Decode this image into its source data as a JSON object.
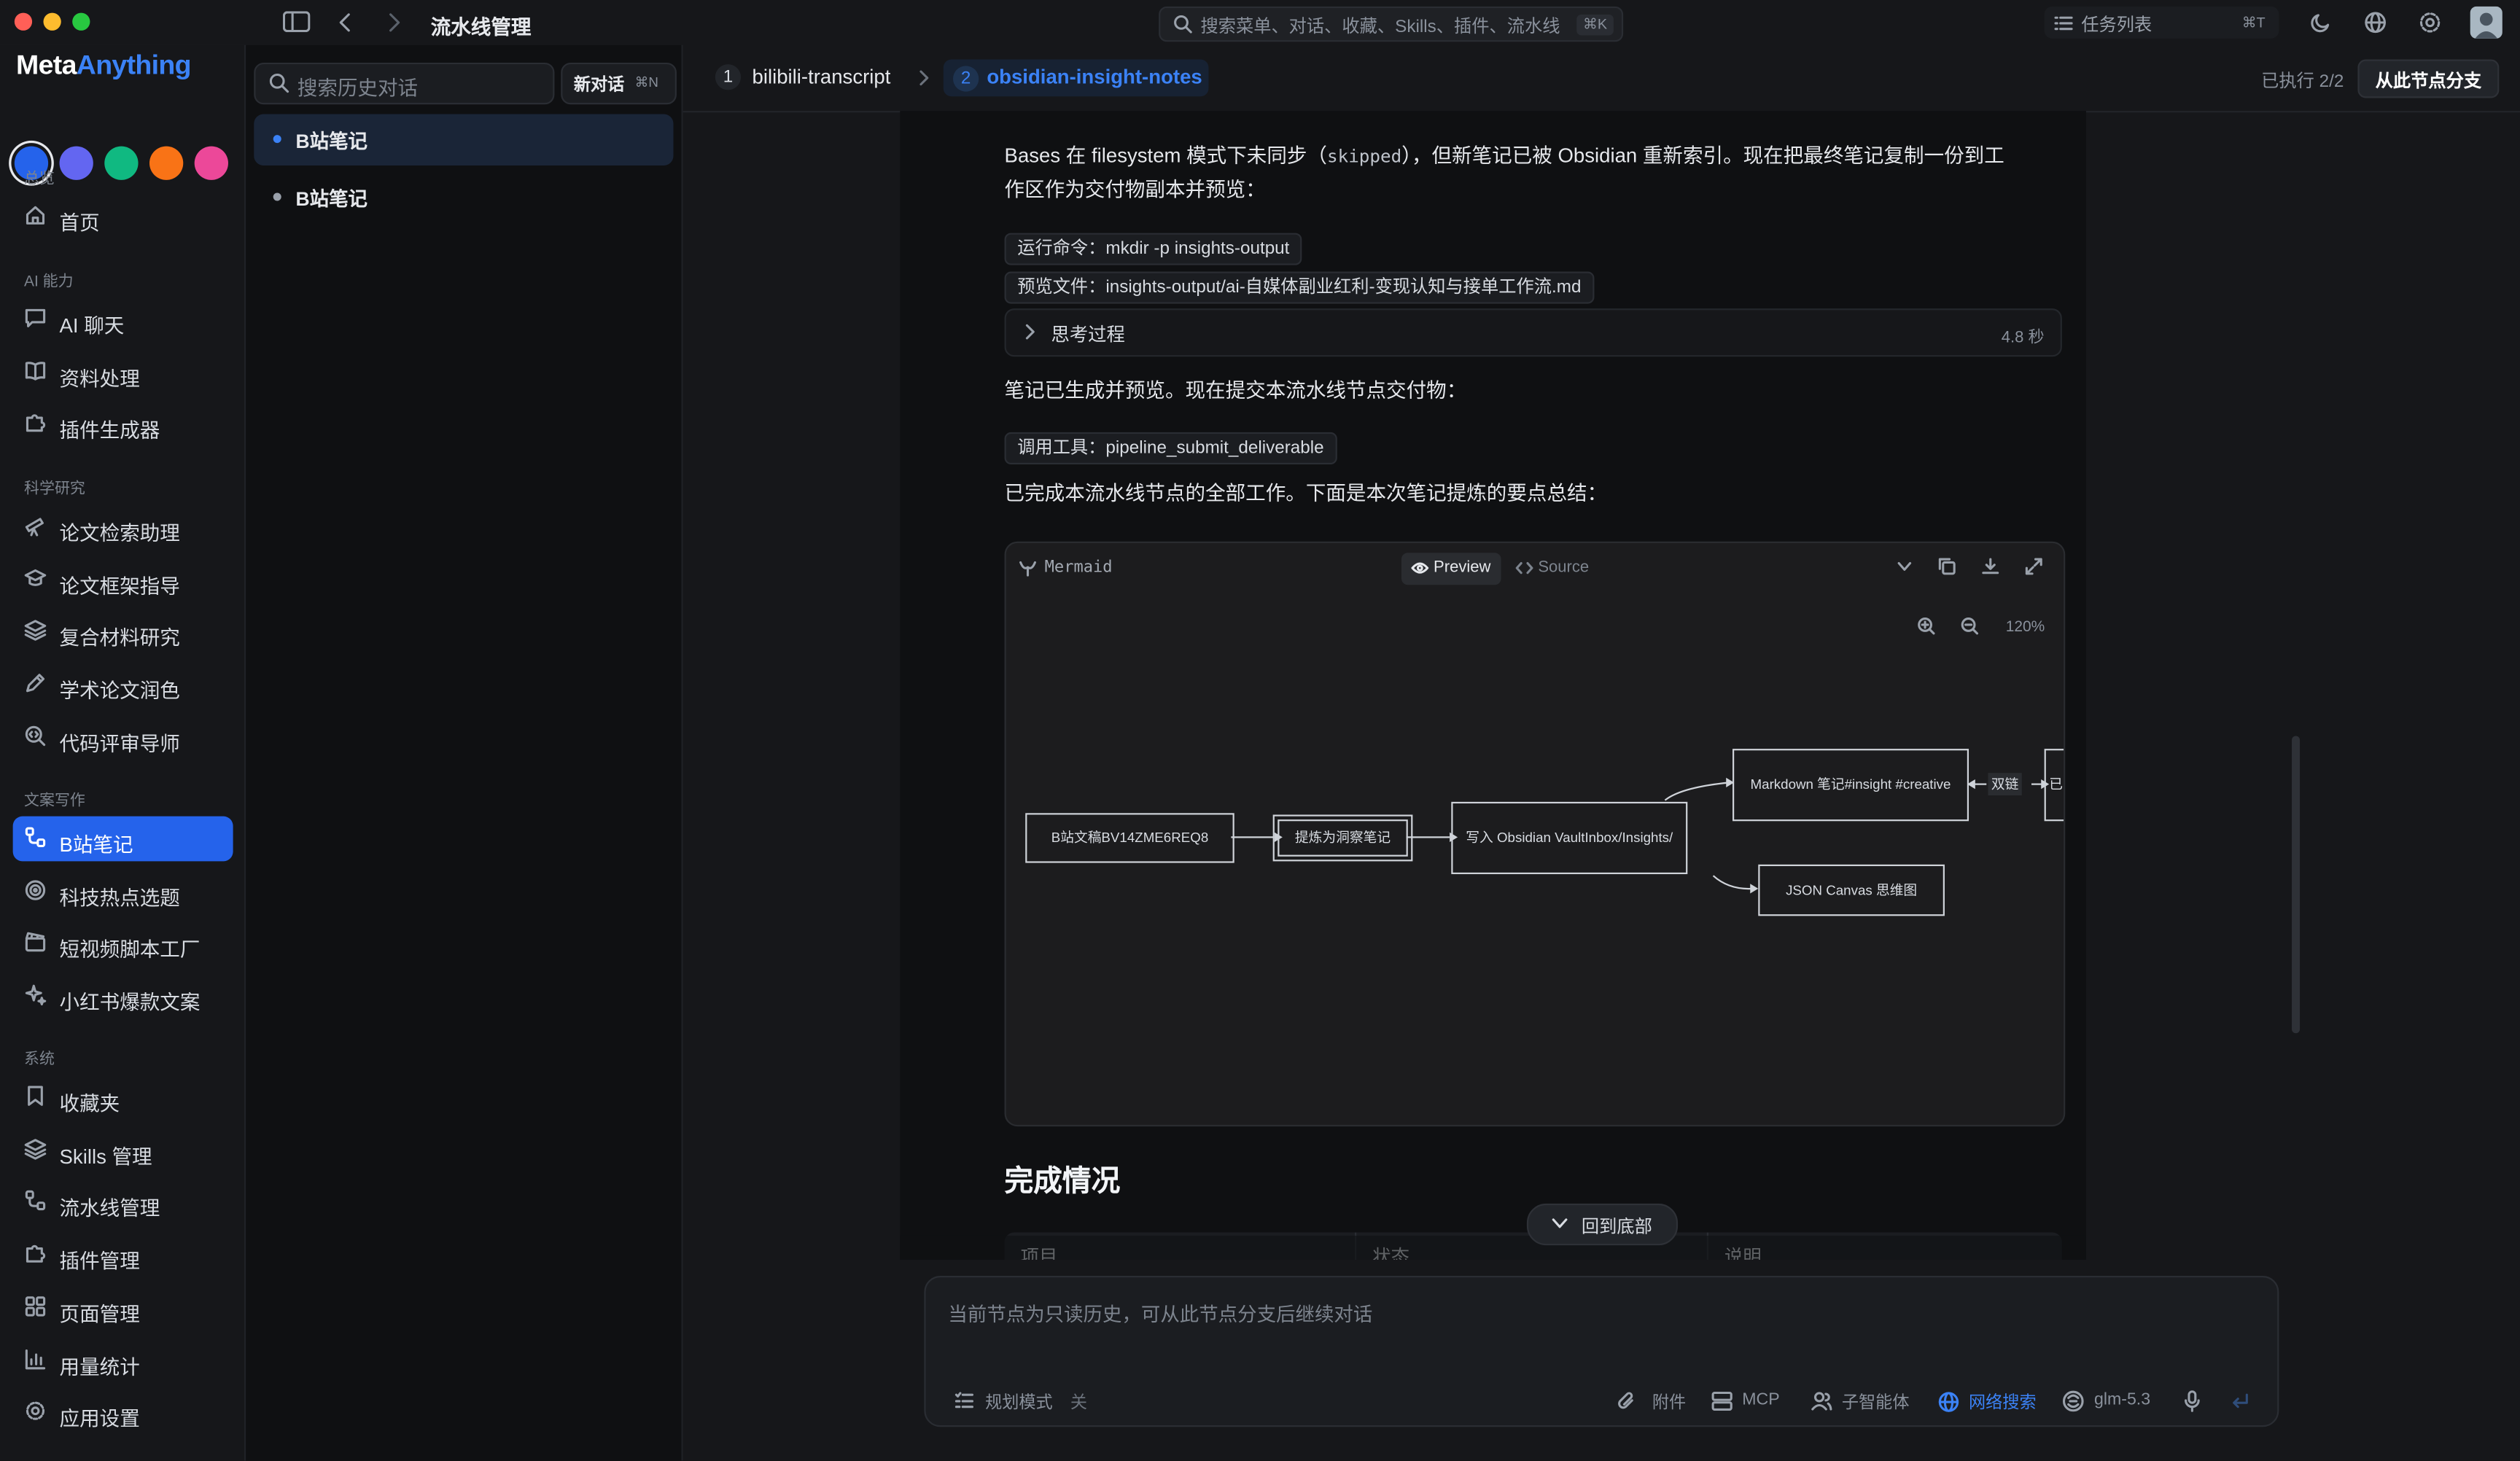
{
  "window": {
    "title": "流水线管理"
  },
  "search": {
    "placeholder": "搜索菜单、对话、收藏、Skills、插件、流水线",
    "shortcut": "⌘K"
  },
  "tasks": {
    "label": "任务列表",
    "shortcut": "⌘T"
  },
  "brand": {
    "part1": "Meta",
    "part2": "Anything",
    "accent": "#3b82f6"
  },
  "theme_colors": [
    "#2563eb",
    "#6366f1",
    "#10b981",
    "#f97316",
    "#ec4899"
  ],
  "sidebar": {
    "sections": [
      {
        "title": "总览",
        "items": [
          {
            "label": "首页",
            "icon": "home-icon"
          }
        ]
      },
      {
        "title": "AI 能力",
        "items": [
          {
            "label": "AI 聊天",
            "icon": "chat-icon"
          },
          {
            "label": "资料处理",
            "icon": "book-icon"
          },
          {
            "label": "插件生成器",
            "icon": "puzzle-icon"
          }
        ]
      },
      {
        "title": "科学研究",
        "items": [
          {
            "label": "论文检索助理",
            "icon": "telescope-icon"
          },
          {
            "label": "论文框架指导",
            "icon": "graduation-cap-icon"
          },
          {
            "label": "复合材料研究",
            "icon": "layers-icon"
          },
          {
            "label": "学术论文润色",
            "icon": "pen-icon"
          },
          {
            "label": "代码评审导师",
            "icon": "code-search-icon"
          }
        ]
      },
      {
        "title": "文案写作",
        "items": [
          {
            "label": "B站笔记",
            "icon": "workflow-icon",
            "active": true
          },
          {
            "label": "科技热点选题",
            "icon": "target-icon"
          },
          {
            "label": "短视频脚本工厂",
            "icon": "clapperboard-icon"
          },
          {
            "label": "小红书爆款文案",
            "icon": "sparkles-icon"
          }
        ]
      },
      {
        "title": "系统",
        "items": [
          {
            "label": "收藏夹",
            "icon": "bookmark-icon"
          },
          {
            "label": "Skills 管理",
            "icon": "layers-icon"
          },
          {
            "label": "流水线管理",
            "icon": "workflow-icon"
          },
          {
            "label": "插件管理",
            "icon": "puzzle-icon"
          },
          {
            "label": "页面管理",
            "icon": "grid-icon"
          },
          {
            "label": "用量统计",
            "icon": "bar-chart-icon"
          },
          {
            "label": "应用设置",
            "icon": "gear-icon"
          }
        ]
      }
    ]
  },
  "history": {
    "search_placeholder": "搜索历史对话",
    "new_chat": "新对话",
    "new_chat_shortcut": "⌘N",
    "items": [
      {
        "label": "B站笔记",
        "active": true
      },
      {
        "label": "B站笔记",
        "active": false
      }
    ]
  },
  "pipeline": {
    "steps": [
      {
        "num": "1",
        "label": "bilibili-transcript",
        "active": false
      },
      {
        "num": "2",
        "label": "obsidian-insight-notes",
        "active": true
      }
    ],
    "status": "已执行 2/2",
    "branch_button": "从此节点分支"
  },
  "message": {
    "para1_a": "Bases 在 filesystem 模式下未同步（",
    "para1_code": "skipped",
    "para1_b": "），但新笔记已被 Obsidian 重新索引。现在把最终笔记复制一份到工",
    "para1_c": "作区作为交付物副本并预览：",
    "cmd1": "运行命令：mkdir -p insights-output",
    "cmd2": "预览文件：insights-output/ai-自媒体副业红利-变现认知与接单工作流.md",
    "thinking_label": "思考过程",
    "thinking_time": "4.8 秒",
    "para2": "笔记已生成并预览。现在提交本流水线节点交付物：",
    "tool_call": "调用工具：pipeline_submit_deliverable",
    "para3": "已完成本流水线节点的全部工作。下面是本次笔记提炼的要点总结："
  },
  "mermaid": {
    "label": "Mermaid",
    "preview": "Preview",
    "source": "Source",
    "zoom": "120%",
    "nodes": {
      "n1": "B站文稿BV14ZME6REQ8",
      "n2": "提炼为洞察笔记",
      "n3": "写入 Obsidian VaultInbox/Insights/",
      "n4": "Markdown 笔记#insight #creative",
      "n5": "JSON Canvas 思维图",
      "n6": "已",
      "edge": "双链"
    }
  },
  "completion": {
    "heading": "完成情况",
    "columns": [
      "项目",
      "状态",
      "说明"
    ],
    "back_to_bottom": "回到底部"
  },
  "composer": {
    "placeholder": "当前节点为只读历史，可从此节点分支后继续对话",
    "plan_mode": "规划模式",
    "plan_state": "关",
    "attach": "附件",
    "mcp": "MCP",
    "subagent": "子智能体",
    "web_search": "网络搜索",
    "model": "glm-5.3"
  }
}
